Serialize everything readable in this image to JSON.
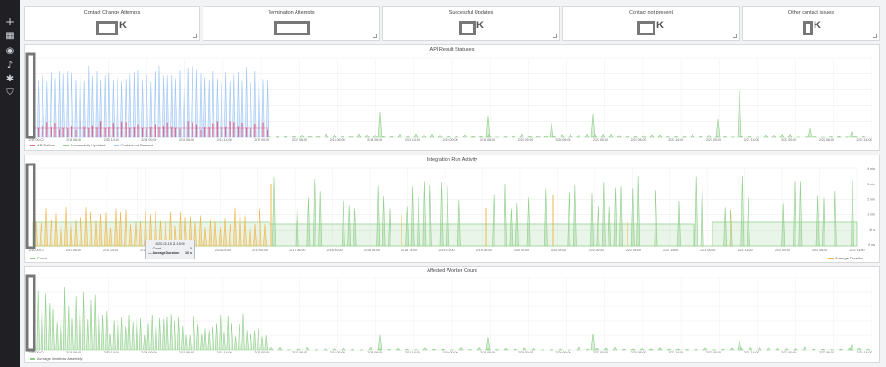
{
  "colors": {
    "blue": "#9ec5f5",
    "pink": "#e46b8e",
    "green": "#8fcf8a",
    "orange": "#f0b64b",
    "grey": "#777777"
  },
  "sidebar": {
    "icons": [
      "plus-icon",
      "dashboard-icon",
      "compass-icon",
      "bell-icon",
      "gear-icon",
      "shield-icon"
    ]
  },
  "stats": [
    {
      "title": "Contact Change Attempts",
      "suffix": "K"
    },
    {
      "title": "Termination Attempts",
      "suffix": ""
    },
    {
      "title": "Successful Updates",
      "suffix": "K"
    },
    {
      "title": "Contact not present",
      "suffix": "K"
    },
    {
      "title": "Other contact issues",
      "suffix": "K"
    }
  ],
  "panels": {
    "api": {
      "title": "API Result Statuses",
      "ticks": [
        "2/13 00:00",
        "2/13 06:00",
        "2/13 14:00",
        "2/14 00:00",
        "2/14 06:00",
        "2/14 14:00",
        "2/17 00:00",
        "2/17 06:00",
        "2/18 00:00",
        "2/18 06:00",
        "2/18 14:00",
        "2/19 00:00",
        "2/19 06:00",
        "2/20 00:00",
        "2/20 06:00",
        "2/22 00:00",
        "2/22 06:00",
        "2/22 14:00",
        "2/21 00:00",
        "2/21 14:00",
        "2/22 00:00",
        "2/22 06:00",
        "2/22 14:00"
      ],
      "legend": [
        "API Failure",
        "Successfully Updated",
        "Contact not Present"
      ]
    },
    "integration": {
      "title": "Integration Run Activity",
      "right_ticks": [
        "4 min",
        "3 min",
        "2 min",
        "1 min",
        "30 s",
        "0 ms"
      ],
      "legend_left": "Count",
      "legend_right": "Average Duration",
      "tooltip": {
        "time": "2020-03-15 21:15:00",
        "count_label": "Count",
        "count_value": "5",
        "dur_label": "Average Duration",
        "dur_value": "10 s"
      }
    },
    "worker": {
      "title": "Affected Worker Count",
      "legend": "Average Workflow Assembly"
    }
  }
}
